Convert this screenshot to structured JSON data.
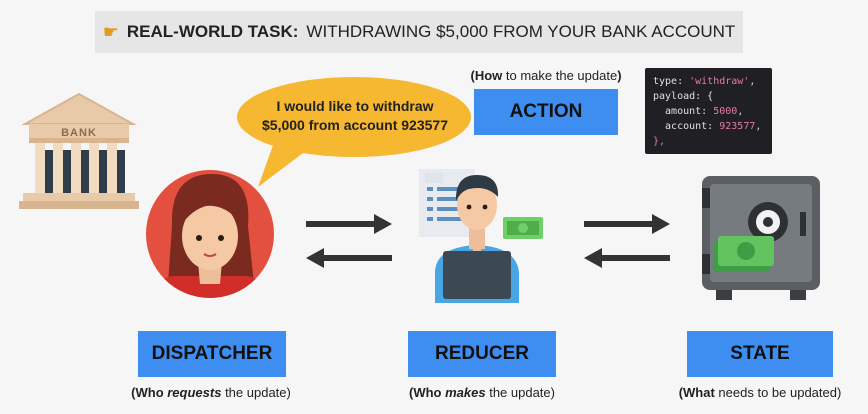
{
  "title": {
    "prefix": "REAL-WORLD TASK:",
    "text": "WITHDRAWING $5,000 FROM YOUR BANK ACCOUNT"
  },
  "bank": {
    "label": "BANK"
  },
  "speech_bubble": {
    "line1": "I would like to withdraw",
    "line2": "$5,000 from account 923577"
  },
  "action": {
    "caption_bold": "How",
    "caption_rest": " to make the update",
    "label": "ACTION"
  },
  "code": {
    "line1_key": "type: ",
    "line1_val": "'withdraw'",
    "line2": "payload: {",
    "line3_key": "  amount: ",
    "line3_val": "5000",
    "line4_key": "  account: ",
    "line4_val": "923577",
    "line5": "},"
  },
  "dispatcher": {
    "label": "DISPATCHER",
    "caption_pre": "(Who ",
    "caption_em": "requests",
    "caption_post": " the update)"
  },
  "reducer": {
    "label": "REDUCER",
    "caption_pre": "(Who ",
    "caption_em": "makes",
    "caption_post": " the update)"
  },
  "state": {
    "label": "STATE",
    "caption_bold": "What",
    "caption_rest": " needs to be updated)",
    "caption_open": "("
  },
  "colors": {
    "blue": "#3d8ef0",
    "bubble": "#f6b731",
    "dispatcher_bg": "#e4503f",
    "reducer_bg": "#49a6e5"
  }
}
